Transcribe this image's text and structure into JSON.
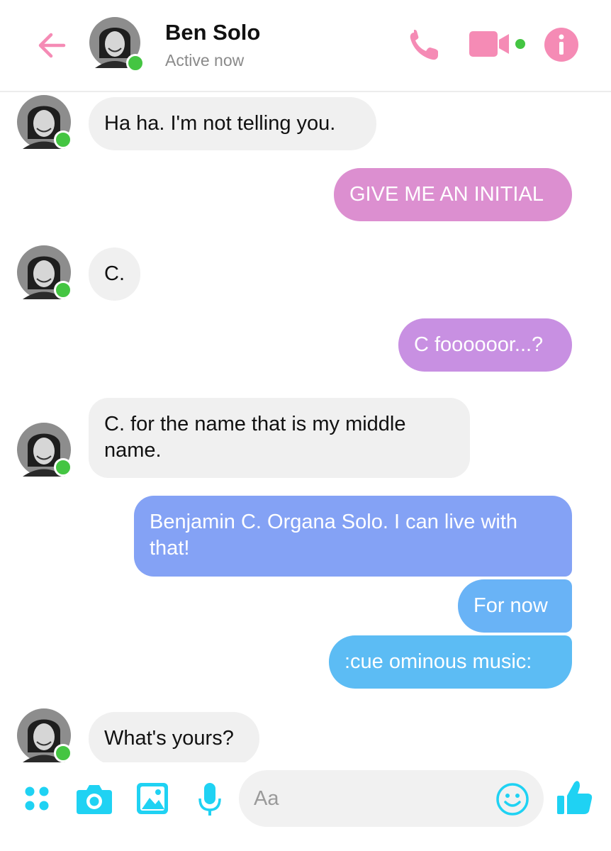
{
  "header": {
    "contact_name": "Ben Solo",
    "status": "Active now",
    "icons": [
      "back-arrow-icon",
      "phone-icon",
      "video-camera-icon",
      "info-icon"
    ]
  },
  "messages": [
    {
      "side": "in",
      "text": "Ha ha. I'm not telling you."
    },
    {
      "side": "out",
      "text": "GIVE ME AN INITIAL"
    },
    {
      "side": "in",
      "text": "C."
    },
    {
      "side": "out",
      "text": "C foooooor...?"
    },
    {
      "side": "in",
      "text": "C. for the name that is my middle name."
    },
    {
      "side": "out",
      "text": "Benjamin C. Organa Solo. I can live with that!"
    },
    {
      "side": "out",
      "text": "For now"
    },
    {
      "side": "out",
      "text": ":cue ominous music:"
    },
    {
      "side": "in",
      "text": "What's yours?"
    }
  ],
  "composer": {
    "placeholder": "Aa",
    "icons": [
      "more-apps-icon",
      "camera-icon",
      "gallery-icon",
      "microphone-icon",
      "emoji-icon",
      "thumbs-up-icon"
    ]
  },
  "colors": {
    "accent_header": "#f58bb5",
    "accent_composer": "#1fd2f3",
    "online": "#44c542",
    "incoming_bubble": "#f0f0f0",
    "outgoing_gradient": [
      "#dc8fd0",
      "#c890e2",
      "#a596ec",
      "#84a2f5",
      "#69b3f6",
      "#5cbcf4"
    ]
  }
}
